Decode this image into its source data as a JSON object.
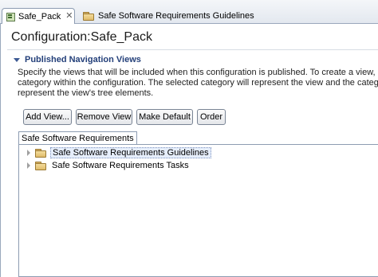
{
  "tabs": [
    {
      "label": "Safe_Pack",
      "close_glyph": "✕",
      "icon": "configuration-icon",
      "active": true
    },
    {
      "label": "Safe Software Requirements Guidelines",
      "icon": "folder-icon",
      "active": false
    }
  ],
  "page_title": "Configuration:Safe_Pack",
  "section": {
    "title": "Published Navigation Views",
    "description_lines": [
      "Specify the views that will be included when this configuration is published. To create a view, click A",
      "category within the configuration.  The selected category will represent the view and the category's s",
      "represent the view's tree elements."
    ]
  },
  "buttons": {
    "add_view": "Add View...",
    "remove_view": "Remove View",
    "make_default": "Make Default",
    "order": "Order"
  },
  "views_tab": {
    "label": "Safe Software Requirements"
  },
  "tree": [
    {
      "label": "Safe Software Requirements Guidelines",
      "icon": "folder-icon",
      "selected": true
    },
    {
      "label": "Safe Software Requirements Tasks",
      "icon": "folder-icon",
      "selected": false
    }
  ],
  "colors": {
    "section_header": "#24407a",
    "selection_fill": "#e6eefb",
    "border": "#8d9cb2"
  }
}
